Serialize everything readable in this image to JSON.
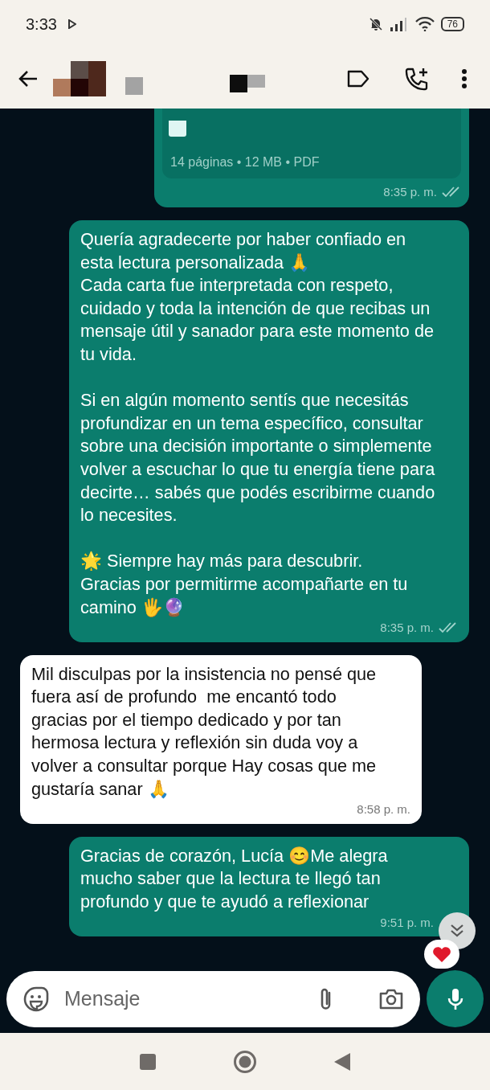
{
  "status_bar": {
    "time": "3:33",
    "battery": "76"
  },
  "messages": [
    {
      "kind": "document",
      "sent": true,
      "meta": "14 páginas • 12 MB • PDF",
      "time": "8:35 p. m.",
      "read": false
    },
    {
      "kind": "text",
      "sent": true,
      "text": "Quería agradecerte por haber confiado en esta lectura personalizada 🙏\nCada carta fue interpretada con respeto, cuidado y toda la intención de que recibas un mensaje útil y sanador para este momento de tu vida.\n\nSi en algún momento sentís que necesitás profundizar en un tema específico, consultar sobre una decisión importante o simplemente volver a escuchar lo que tu energía tiene para decirte… sabés que podés escribirme cuando lo necesites.\n\n🌟 Siempre hay más para descubrir.\nGracias por permitirme acompañarte en tu camino 🖐️🔮",
      "time": "8:35 p. m.",
      "read": false
    },
    {
      "kind": "text",
      "sent": false,
      "text": "Mil disculpas por la insistencia no pensé que fuera así de profundo  me encantó todo gracias por el tiempo dedicado y por tan hermosa lectura y reflexión sin duda voy a volver a consultar porque Hay cosas que me gustaría sanar 🙏",
      "time": "8:58 p. m."
    },
    {
      "kind": "text",
      "sent": true,
      "text": "Gracias de corazón, Lucía 😊Me alegra mucho saber que la lectura te llegó tan profundo y que te ayudó a reflexionar",
      "time": "9:51 p. m."
    }
  ],
  "composer": {
    "placeholder": "Mensaje"
  }
}
